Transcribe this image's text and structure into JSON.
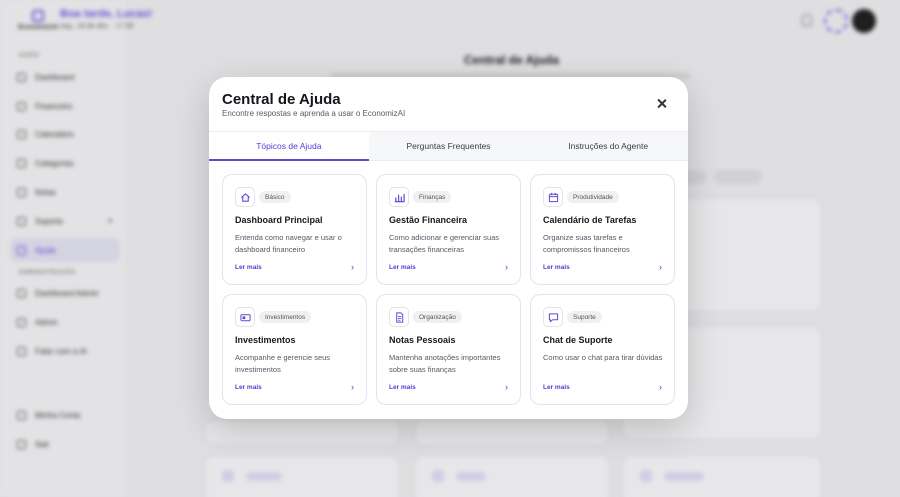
{
  "sidebar": {
    "brand": "EconomizAI",
    "sections": {
      "main": "VISÃO",
      "admin": "ADMINISTRAÇÃO"
    },
    "items": [
      {
        "label": "Dashboard"
      },
      {
        "label": "Financeiro"
      },
      {
        "label": "Calendário"
      },
      {
        "label": "Categorias"
      },
      {
        "label": "Notas"
      },
      {
        "label": "Suporte"
      },
      {
        "label": "Ajuda"
      }
    ],
    "admin_items": [
      {
        "label": "Dashboard Admin"
      },
      {
        "label": "Admin"
      },
      {
        "label": "Falar com a IA"
      }
    ],
    "footer": [
      {
        "label": "Minha Conta"
      },
      {
        "label": "Sair"
      }
    ]
  },
  "topbar": {
    "greeting": "Boa tarde, Lucas!",
    "date": "seg., 18 de dez. · 17:30"
  },
  "background": {
    "page_title": "Central de Ajuda"
  },
  "modal": {
    "title": "Central de Ajuda",
    "subtitle": "Encontre respostas e aprenda a usar o EconomizAI",
    "tabs": [
      {
        "label": "Tópicos de Ajuda"
      },
      {
        "label": "Perguntas Frequentes"
      },
      {
        "label": "Instruções do Agente"
      }
    ],
    "cards": [
      {
        "badge": "Básico",
        "title": "Dashboard Principal",
        "desc": "Entenda como navegar e usar o dashboard financeiro",
        "link": "Ler mais",
        "icon": "home-icon"
      },
      {
        "badge": "Finanças",
        "title": "Gestão Financeira",
        "desc": "Como adicionar e gerenciar suas transações financeiras",
        "link": "Ler mais",
        "icon": "bar-chart-icon"
      },
      {
        "badge": "Produtividade",
        "title": "Calendário de Tarefas",
        "desc": "Organize suas tarefas e compromissos financeiros",
        "link": "Ler mais",
        "icon": "calendar-icon"
      },
      {
        "badge": "Investimentos",
        "title": "Investimentos",
        "desc": "Acompanhe e gerencie seus investimentos",
        "link": "Ler mais",
        "icon": "wallet-icon"
      },
      {
        "badge": "Organização",
        "title": "Notas Pessoais",
        "desc": "Mantenha anotações importantes sobre suas finanças",
        "link": "Ler mais",
        "icon": "document-icon"
      },
      {
        "badge": "Suporte",
        "title": "Chat de Suporte",
        "desc": "Como usar o chat para tirar dúvidas",
        "link": "Ler mais",
        "icon": "chat-icon"
      }
    ]
  },
  "colors": {
    "accent": "#5b4bd6",
    "accent_light": "#e7e5f6"
  }
}
